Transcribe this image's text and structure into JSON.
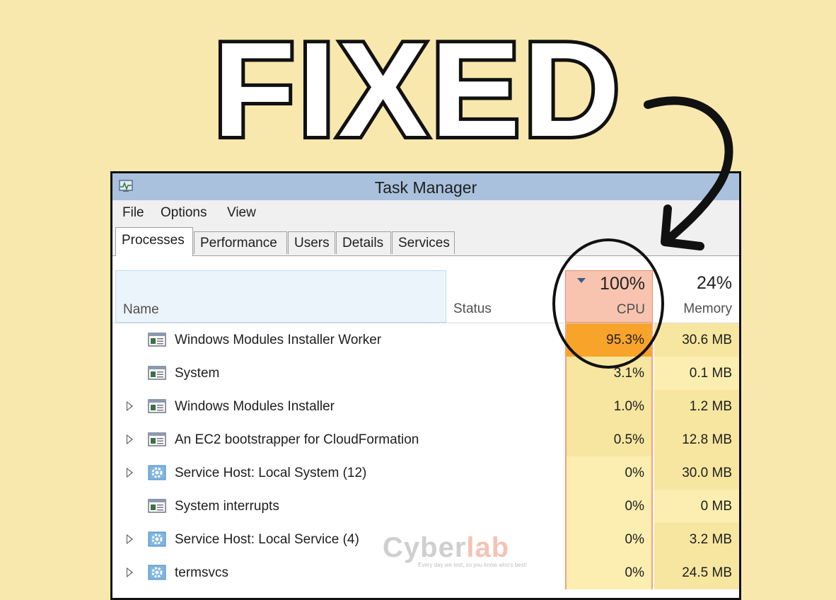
{
  "headline": "FIXED",
  "window": {
    "title": "Task Manager"
  },
  "menu": [
    "File",
    "Options",
    "View"
  ],
  "tabs": [
    "Processes",
    "Performance",
    "Users",
    "Details",
    "Services"
  ],
  "active_tab": "Processes",
  "columns": {
    "name": "Name",
    "status": "Status",
    "cpu": {
      "label": "CPU",
      "total": "100%"
    },
    "memory": {
      "label": "Memory",
      "total": "24%"
    }
  },
  "processes": [
    {
      "name": "Windows Modules Installer Worker",
      "cpu": "95.3%",
      "memory": "30.6 MB",
      "expandable": false,
      "icon": "app-window-icon"
    },
    {
      "name": "System",
      "cpu": "3.1%",
      "memory": "0.1 MB",
      "expandable": false,
      "icon": "app-window-icon"
    },
    {
      "name": "Windows Modules Installer",
      "cpu": "1.0%",
      "memory": "1.2 MB",
      "expandable": true,
      "icon": "app-window-icon"
    },
    {
      "name": "An EC2 bootstrapper for CloudFormation",
      "cpu": "0.5%",
      "memory": "12.8 MB",
      "expandable": true,
      "icon": "app-window-icon"
    },
    {
      "name": "Service Host: Local System (12)",
      "cpu": "0%",
      "memory": "30.0 MB",
      "expandable": true,
      "icon": "gear-icon"
    },
    {
      "name": "System interrupts",
      "cpu": "0%",
      "memory": "0 MB",
      "expandable": false,
      "icon": "app-window-icon"
    },
    {
      "name": "Service Host: Local Service (4)",
      "cpu": "0%",
      "memory": "3.2 MB",
      "expandable": true,
      "icon": "gear-icon"
    },
    {
      "name": "termsvcs",
      "cpu": "0%",
      "memory": "24.5 MB",
      "expandable": true,
      "icon": "gear-icon"
    }
  ],
  "watermark": {
    "brand_a": "Cyber",
    "brand_b": "lab",
    "tagline": "Every day we test, so you know who's best!"
  },
  "colors": {
    "background": "#f9e8ad",
    "cpu_high": "#f8a42a",
    "cpu_low": "#fbeeb0",
    "header_cpu": "#f8c4b0",
    "titlebar": "#a9c1dd"
  }
}
